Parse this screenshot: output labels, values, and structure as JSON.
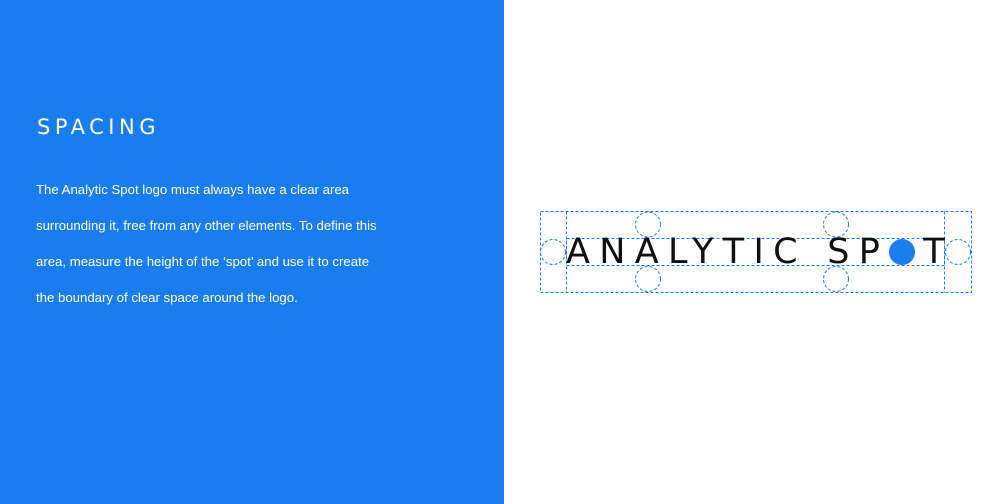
{
  "spacing_section": {
    "heading": "SPACING",
    "body_lines": [
      "The Analytic Spot logo must always have a clear area",
      "surrounding it, free from any other elements. To define this",
      "area, measure the height of the ‘spot’ and use it to create",
      "the boundary of clear space around the logo."
    ]
  },
  "logo": {
    "text_part1": "ANALYTIC SP",
    "text_part2": "T",
    "spot_color": "#1a7ded",
    "guide_color": "#1a7ded"
  },
  "colors": {
    "brand_blue": "#1a7ded",
    "background_white": "#ffffff",
    "logo_text": "#111111"
  }
}
